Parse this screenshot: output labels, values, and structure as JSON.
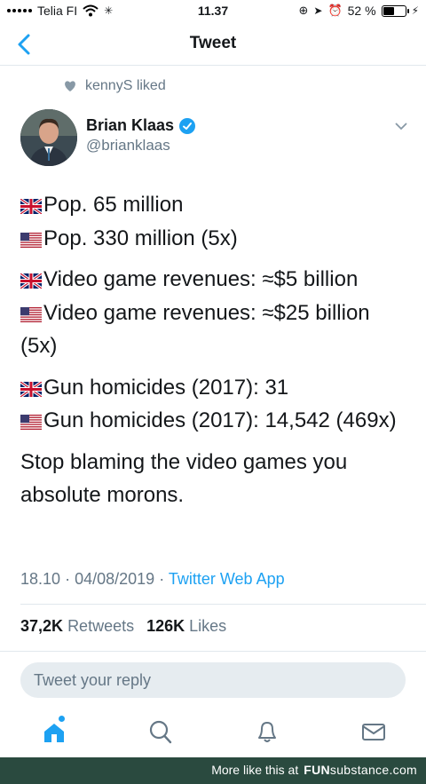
{
  "status": {
    "carrier": "Telia FI",
    "time": "11.37",
    "battery": "52 %",
    "battery_level": 0.52
  },
  "nav": {
    "title": "Tweet"
  },
  "social_context": {
    "text": "kennyS liked"
  },
  "author": {
    "name": "Brian Klaas",
    "handle": "@brianklaas"
  },
  "tweet": {
    "lines": [
      {
        "flag": "uk",
        "text": "Pop. 65 million"
      },
      {
        "flag": "us",
        "text": "Pop. 330 million (5x)"
      },
      {
        "flag": "uk",
        "text": "Video game revenues: ≈$5 billion"
      },
      {
        "flag": "us",
        "text": "Video game revenues: ≈$25 billion (5x)"
      },
      {
        "flag": "uk",
        "text": "Gun homicides (2017): 31"
      },
      {
        "flag": "us",
        "text": "Gun homicides (2017): 14,542 (469x)"
      }
    ],
    "closing_line1": "Stop blaming the video games you",
    "closing_line2": "absolute morons."
  },
  "meta": {
    "time": "18.10",
    "separator": "·",
    "date": "04/08/2019",
    "source": "Twitter Web App"
  },
  "stats": {
    "retweets_count": "37,2K",
    "retweets_label": "Retweets",
    "likes_count": "126K",
    "likes_label": "Likes"
  },
  "reply": {
    "placeholder": "Tweet your reply"
  },
  "tabs": [
    "home-icon",
    "search-icon",
    "bell-icon",
    "mail-icon"
  ],
  "watermark": {
    "text": "More like this at",
    "brand_bold": "FUN",
    "brand_rest": "substance",
    "brand_tld": ".com"
  },
  "colors": {
    "accent": "#1da1f2",
    "secondary_text": "#657786",
    "footer_bg": "#2a4a3f"
  }
}
